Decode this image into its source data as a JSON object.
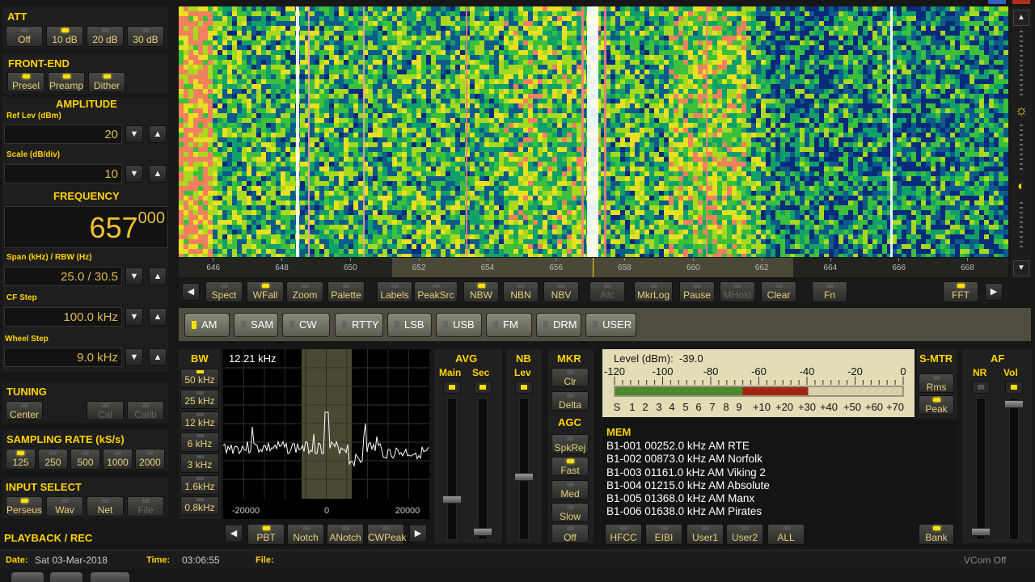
{
  "att": {
    "title": "ATT",
    "buttons": [
      {
        "label": "Off",
        "on": false
      },
      {
        "label": "10 dB",
        "on": true
      },
      {
        "label": "20 dB",
        "on": false
      },
      {
        "label": "30 dB",
        "on": false
      }
    ]
  },
  "frontend": {
    "title": "FRONT-END",
    "buttons": [
      {
        "label": "Presel",
        "on": true
      },
      {
        "label": "Preamp",
        "on": true
      },
      {
        "label": "Dither",
        "on": true
      }
    ]
  },
  "amplitude": {
    "title": "AMPLITUDE",
    "ref_label": "Ref Lev (dBm)",
    "ref_value": "20",
    "scale_label": "Scale (dB/div)",
    "scale_value": "10"
  },
  "frequency": {
    "title": "FREQUENCY",
    "main": "657",
    "sub": "000",
    "span_label": "Span (kHz) / RBW (Hz)",
    "span_value": "25.0 / 30.5",
    "cfstep_label": "CF Step",
    "cfstep_value": "100.0 kHz",
    "wheel_label": "Wheel Step",
    "wheel_value": "9.0 kHz"
  },
  "tuning": {
    "title": "TUNING",
    "buttons": [
      {
        "label": "Center",
        "on": false,
        "enabled": true
      },
      {
        "label": "Cal",
        "on": false,
        "enabled": false
      },
      {
        "label": "Calib",
        "on": false,
        "enabled": false
      }
    ]
  },
  "sampling": {
    "title": "SAMPLING RATE (kS/s)",
    "buttons": [
      {
        "label": "125",
        "on": true
      },
      {
        "label": "250",
        "on": false
      },
      {
        "label": "500",
        "on": false
      },
      {
        "label": "1000",
        "on": false
      },
      {
        "label": "2000",
        "on": false
      }
    ]
  },
  "input": {
    "title": "INPUT SELECT",
    "buttons": [
      {
        "label": "Perseus",
        "on": true,
        "enabled": true
      },
      {
        "label": "Wav",
        "on": false,
        "enabled": true
      },
      {
        "label": "Net",
        "on": false,
        "enabled": true
      },
      {
        "label": "File",
        "on": false,
        "enabled": false
      }
    ]
  },
  "playback": {
    "title": "PLAYBACK / REC"
  },
  "statusbar": {
    "date_label": "Date:",
    "date": "Sat 03-Mar-2018",
    "time_label": "Time:",
    "time": "03:06:55",
    "file_label": "File:",
    "vcom": "VCom Off"
  },
  "waterfall": {
    "freq_ticks": [
      "646",
      "648",
      "650",
      "652",
      "654",
      "656",
      "658",
      "660",
      "662",
      "664",
      "666",
      "668"
    ],
    "freq_range": [
      645,
      669.2
    ],
    "center": 657
  },
  "toolbar": {
    "buttons": [
      {
        "label": "Spect",
        "on": false,
        "enabled": true
      },
      {
        "label": "WFall",
        "on": true,
        "enabled": true
      },
      {
        "label": "Zoom",
        "on": false,
        "enabled": true
      },
      {
        "label": "Palette",
        "on": false,
        "enabled": true
      },
      {
        "label": "Labels",
        "on": false,
        "enabled": true
      },
      {
        "label": "PeakSrc",
        "on": false,
        "enabled": true
      },
      {
        "label": "NBW",
        "on": true,
        "enabled": true
      },
      {
        "label": "NBN",
        "on": false,
        "enabled": true
      },
      {
        "label": "NBV",
        "on": false,
        "enabled": true
      },
      {
        "label": "Afc",
        "on": false,
        "enabled": false
      },
      {
        "label": "MkrLog",
        "on": false,
        "enabled": true
      },
      {
        "label": "Pause",
        "on": false,
        "enabled": true
      },
      {
        "label": "MHold",
        "on": false,
        "enabled": false
      },
      {
        "label": "Clear",
        "on": false,
        "enabled": true
      },
      {
        "label": "Fn",
        "on": false,
        "enabled": true
      },
      {
        "label": "FFT",
        "on": true,
        "enabled": true
      }
    ]
  },
  "modes": [
    {
      "label": "AM",
      "on": true
    },
    {
      "label": "SAM",
      "on": false
    },
    {
      "label": "CW",
      "on": false
    },
    {
      "label": "RTTY",
      "on": false
    },
    {
      "label": "LSB",
      "on": false
    },
    {
      "label": "USB",
      "on": false
    },
    {
      "label": "FM",
      "on": false
    },
    {
      "label": "DRM",
      "on": false
    },
    {
      "label": "USER",
      "on": false
    }
  ],
  "bw": {
    "title": "BW",
    "buttons": [
      {
        "label": "50 kHz",
        "on": true
      },
      {
        "label": "25 kHz",
        "on": false
      },
      {
        "label": "12 kHz",
        "on": false
      },
      {
        "label": "6 kHz",
        "on": false
      },
      {
        "label": "3 kHz",
        "on": false
      },
      {
        "label": "1.6kHz",
        "on": false
      },
      {
        "label": "0.8kHz",
        "on": false
      }
    ],
    "value": "12.21 kHz",
    "ticks": [
      "-20000",
      "0",
      "20000"
    ]
  },
  "filter_bar": {
    "buttons": [
      {
        "label": "PBT",
        "on": true
      },
      {
        "label": "Notch",
        "on": false
      },
      {
        "label": "ANotch",
        "on": false
      },
      {
        "label": "CWPeak",
        "on": false
      }
    ]
  },
  "avg": {
    "title": "AVG",
    "main_label": "Main",
    "sec_label": "Sec"
  },
  "nb": {
    "title": "NB",
    "lev_label": "Lev"
  },
  "mkr": {
    "title": "MKR",
    "buttons": [
      {
        "label": "Clr",
        "on": false
      },
      {
        "label": "Delta",
        "on": false
      }
    ]
  },
  "agc": {
    "title": "AGC",
    "buttons": [
      {
        "label": "SpkRej",
        "on": false
      },
      {
        "label": "Fast",
        "on": true
      },
      {
        "label": "Med",
        "on": false
      },
      {
        "label": "Slow",
        "on": false
      },
      {
        "label": "Off",
        "on": false
      }
    ]
  },
  "smeter": {
    "level_label": "Level (dBm):",
    "level_value": "-39.0",
    "dbm_scale": [
      "-120",
      "-100",
      "-80",
      "-60",
      "-40",
      "-20",
      "0"
    ],
    "s_scale": [
      "S",
      "1",
      "2",
      "3",
      "4",
      "5",
      "6",
      "7",
      "8",
      "9",
      "+10",
      "+20",
      "+30",
      "+40",
      "+50",
      "+60",
      "+70"
    ],
    "level_fraction": 0.668,
    "title": "S-MTR",
    "buttons": [
      {
        "label": "Rms",
        "on": false
      },
      {
        "label": "Peak",
        "on": true
      }
    ]
  },
  "mem": {
    "title": "MEM",
    "rows": [
      "B1-001 00252.0 kHz  AM  RTE",
      "B1-002 00873.0 kHz  AM  Norfolk",
      "B1-003 01161.0 kHz  AM  Viking 2",
      "B1-004 01215.0 kHz  AM  Absolute",
      "B1-005 01368.0 kHz  AM  Manx",
      "B1-006 01638.0 kHz  AM  Pirates"
    ],
    "buttons": [
      {
        "label": "HFCC",
        "on": false
      },
      {
        "label": "EIBI",
        "on": false
      },
      {
        "label": "User1",
        "on": false
      },
      {
        "label": "User2",
        "on": false
      },
      {
        "label": "ALL",
        "on": false
      },
      {
        "label": "Bank",
        "on": true
      }
    ]
  },
  "af": {
    "title": "AF",
    "nr_label": "NR",
    "vol_label": "Vol"
  },
  "colors": {
    "accent": "#ffd400",
    "led_on": "#ffe000",
    "smeter_green": "#4a8a2a",
    "smeter_red": "#a02810",
    "panel_tan": "#e0d8b0"
  }
}
